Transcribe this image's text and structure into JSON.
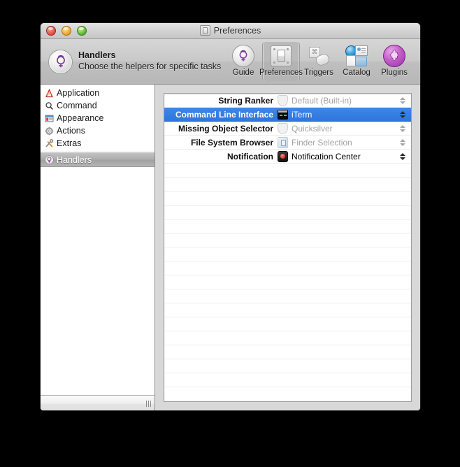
{
  "window": {
    "title": "Preferences",
    "proxy_icon": "document-proxy-icon",
    "traffic_lights": [
      {
        "name": "close-button",
        "color": "#e8554a"
      },
      {
        "name": "minimize-button",
        "color": "#f0ab32"
      },
      {
        "name": "zoom-button",
        "color": "#62bd3c"
      }
    ]
  },
  "header": {
    "logo_icon": "quicksilver-logo-icon",
    "title": "Handlers",
    "subtitle": "Choose the helpers for specific tasks"
  },
  "toolbar": {
    "items": [
      {
        "label": "Guide",
        "icon": "quicksilver-guide-icon",
        "selected": false
      },
      {
        "label": "Preferences",
        "icon": "preferences-switch-icon",
        "selected": true
      },
      {
        "label": "Triggers",
        "icon": "triggers-tag-icon",
        "selected": false
      },
      {
        "label": "Catalog",
        "icon": "catalog-globe-folder-icon",
        "selected": false
      },
      {
        "label": "Plugins",
        "icon": "plugins-puzzle-icon",
        "selected": false
      }
    ]
  },
  "sidebar": {
    "items": [
      {
        "label": "Application",
        "icon": "application-icon",
        "selected": false
      },
      {
        "label": "Command",
        "icon": "magnifier-icon",
        "selected": false
      },
      {
        "label": "Appearance",
        "icon": "appearance-window-icon",
        "selected": false
      },
      {
        "label": "Actions",
        "icon": "gear-icon",
        "selected": false
      },
      {
        "label": "Extras",
        "icon": "tools-icon",
        "selected": false
      }
    ],
    "selected_item": {
      "label": "Handlers",
      "icon": "quicksilver-handlers-icon",
      "selected": true
    },
    "footer_grip": "resize-grip-icon"
  },
  "handlers_table": {
    "rows": [
      {
        "label": "String Ranker",
        "value": "Default (Built-in)",
        "icon": "shield-icon",
        "dimmed": true,
        "selected": false,
        "stepper": "light"
      },
      {
        "label": "Command Line Interface",
        "value": "iTerm",
        "icon": "terminal-icon",
        "dimmed": false,
        "selected": true,
        "stepper": "dark"
      },
      {
        "label": "Missing Object Selector",
        "value": "Quicksilver",
        "icon": "shield-icon",
        "dimmed": true,
        "selected": false,
        "stepper": "light"
      },
      {
        "label": "File System Browser",
        "value": "Finder Selection",
        "icon": "finder-icon",
        "dimmed": true,
        "selected": false,
        "stepper": "light"
      },
      {
        "label": "Notification",
        "value": "Notification Center",
        "icon": "notification-icon",
        "dimmed": false,
        "selected": false,
        "stepper": "dark"
      }
    ],
    "empty_row_count": 21,
    "selection_color": "#3479dd"
  }
}
